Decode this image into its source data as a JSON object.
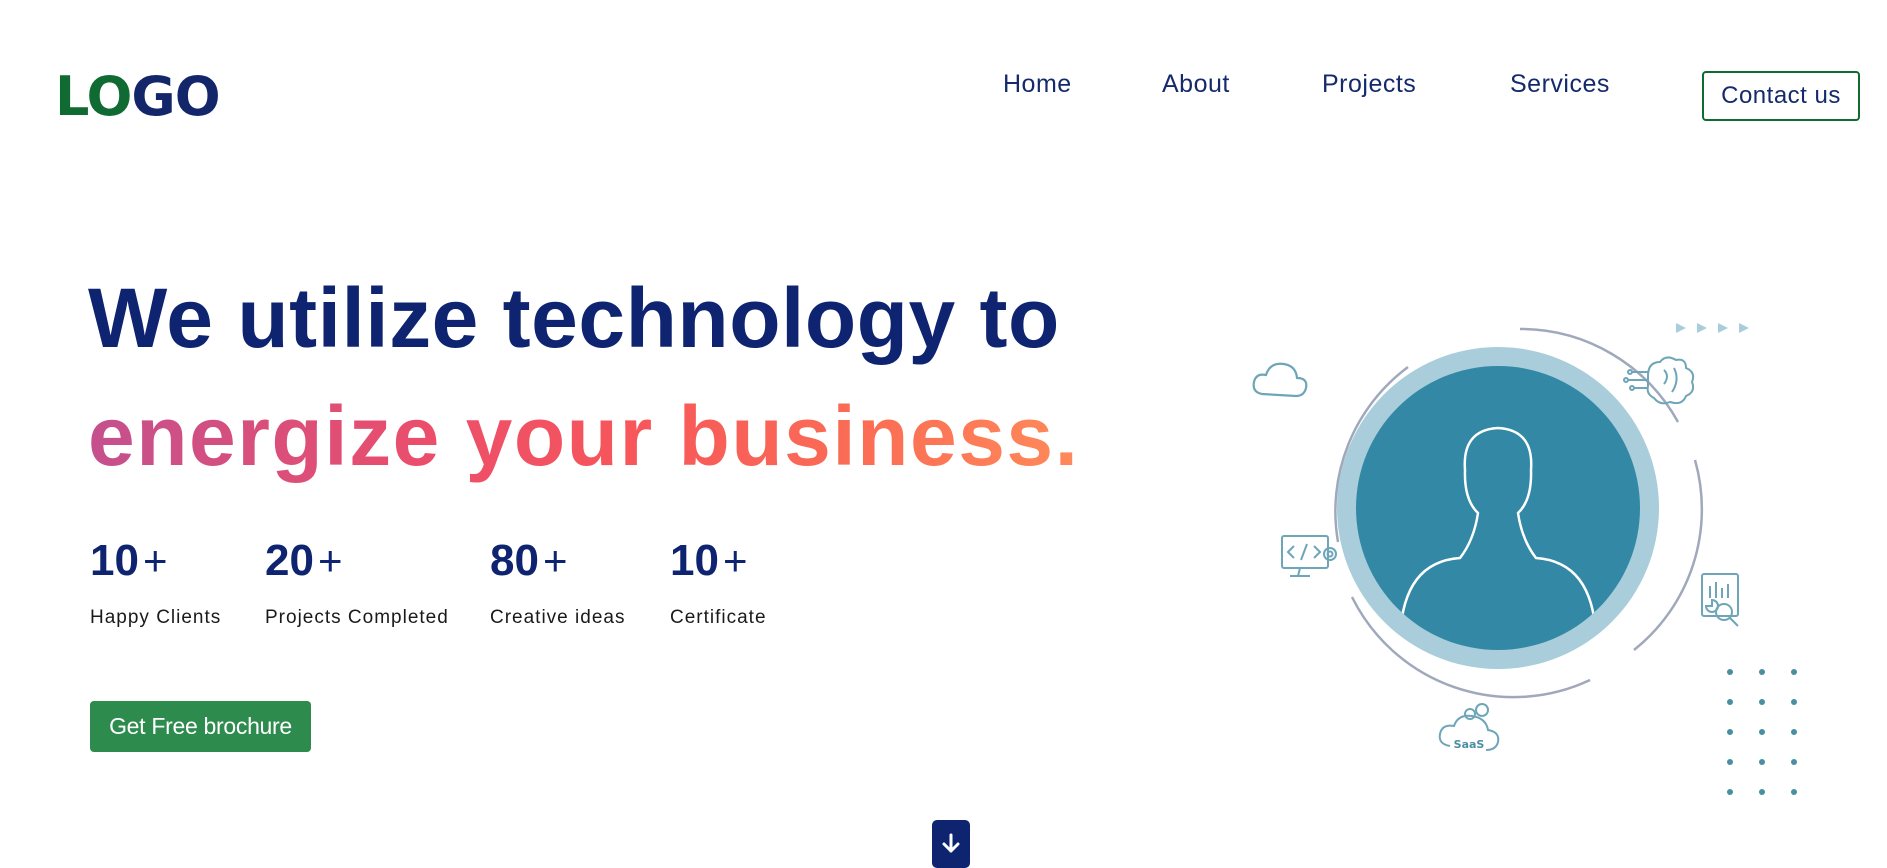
{
  "header": {
    "logo_part1": "LO",
    "logo_part2": "GO",
    "nav": {
      "home": "Home",
      "about": "About",
      "projects": "Projects",
      "services": "Services"
    },
    "contact_label": "Contact us"
  },
  "hero": {
    "line1": "We utilize technology to",
    "line2": "energize your business.",
    "stats": [
      {
        "number": "10",
        "suffix": "+",
        "label": "Happy Clients"
      },
      {
        "number": "20",
        "suffix": "+",
        "label": "Projects Completed"
      },
      {
        "number": "80",
        "suffix": "+",
        "label": "Creative ideas"
      },
      {
        "number": "10",
        "suffix": "+",
        "label": "Certificate"
      }
    ],
    "cta_label": "Get Free brochure"
  },
  "illustration": {
    "saas_label": "SaaS",
    "icons": [
      "cloud-icon",
      "ai-brain-icon",
      "code-monitor-icon",
      "analytics-report-icon",
      "saas-cloud-icon",
      "user-silhouette-icon",
      "arrow-down-icon"
    ]
  },
  "colors": {
    "navy": "#0f2470",
    "green": "#0f6b32",
    "button_green": "#2e8b4e",
    "teal": "#3288a5",
    "gradient_start": "#c4508e",
    "gradient_end": "#ff8a5a"
  }
}
